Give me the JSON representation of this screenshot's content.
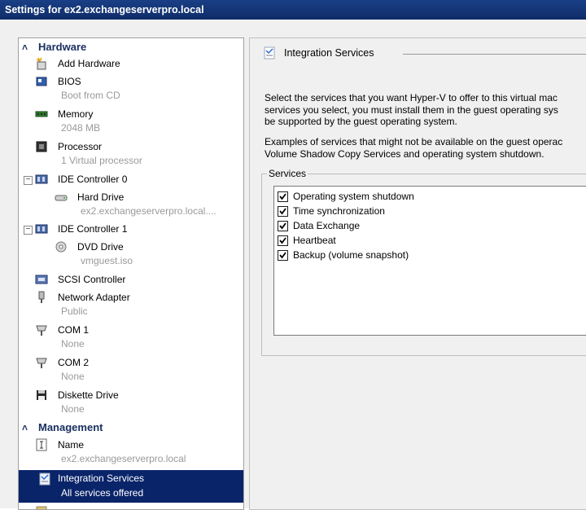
{
  "window": {
    "title": "Settings for ex2.exchangeserverpro.local"
  },
  "hardware": {
    "header": "Hardware",
    "items": [
      {
        "label": "Add Hardware"
      },
      {
        "label": "BIOS",
        "sub": "Boot from CD"
      },
      {
        "label": "Memory",
        "sub": "2048 MB"
      },
      {
        "label": "Processor",
        "sub": "1 Virtual processor"
      },
      {
        "label": "IDE Controller 0"
      },
      {
        "label": "Hard Drive",
        "sub": "ex2.exchangeserverpro.local...."
      },
      {
        "label": "IDE Controller 1"
      },
      {
        "label": "DVD Drive",
        "sub": "vmguest.iso"
      },
      {
        "label": "SCSI Controller"
      },
      {
        "label": "Network Adapter",
        "sub": "Public"
      },
      {
        "label": "COM 1",
        "sub": "None"
      },
      {
        "label": "COM 2",
        "sub": "None"
      },
      {
        "label": "Diskette Drive",
        "sub": "None"
      }
    ]
  },
  "management": {
    "header": "Management",
    "items": [
      {
        "label": "Name",
        "sub": "ex2.exchangeserverpro.local"
      },
      {
        "label": "Integration Services",
        "sub": "All services offered",
        "selected": true
      }
    ]
  },
  "panel": {
    "title": "Integration Services",
    "description_lines": [
      "Select the services that you want Hyper-V to offer to this virtual mac",
      "services you select, you must install them in the guest operating sys",
      "be supported by the guest operating system."
    ],
    "examples_lines": [
      "Examples of services that might not be available on the guest operac",
      "Volume Shadow Copy Services and operating system shutdown."
    ],
    "services_legend": "Services",
    "services": [
      {
        "label": "Operating system shutdown",
        "checked": true
      },
      {
        "label": "Time synchronization",
        "checked": true
      },
      {
        "label": "Data Exchange",
        "checked": true
      },
      {
        "label": "Heartbeat",
        "checked": true
      },
      {
        "label": "Backup (volume snapshot)",
        "checked": true
      }
    ]
  },
  "colors": {
    "selection": "#0a246a",
    "titlebar": "#0f2c68",
    "section_header": "#1a3060"
  }
}
